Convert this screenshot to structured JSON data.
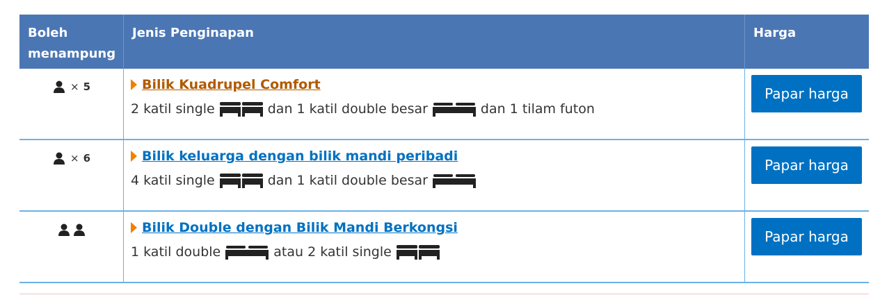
{
  "header": {
    "occupancy": "Boleh menampung",
    "accommodation": "Jenis Penginapan",
    "price": "Harga"
  },
  "colors": {
    "header_bg": "#4b76b4",
    "link_orange": "#b05a00",
    "link_blue": "#0071c2",
    "button": "#0071c2",
    "arrow": "#f08000"
  },
  "rooms": [
    {
      "occupancy_multiplier": "×",
      "occupancy_count": "5",
      "name": "Bilik Kuadrupel Comfort",
      "bed_part1": "2 katil single",
      "bed_part2": "dan 1 katil double besar",
      "bed_part3": "dan 1 tilam futon",
      "button": "Papar harga"
    },
    {
      "occupancy_multiplier": "×",
      "occupancy_count": "6",
      "name": "Bilik keluarga dengan bilik mandi peribadi",
      "bed_part1": "4 katil single",
      "bed_part2": "dan 1 katil double besar",
      "button": "Papar harga"
    },
    {
      "name": "Bilik Double dengan Bilik Mandi Berkongsi",
      "bed_part1": "1 katil double",
      "bed_part2": "atau 2 katil single",
      "button": "Papar harga"
    }
  ]
}
